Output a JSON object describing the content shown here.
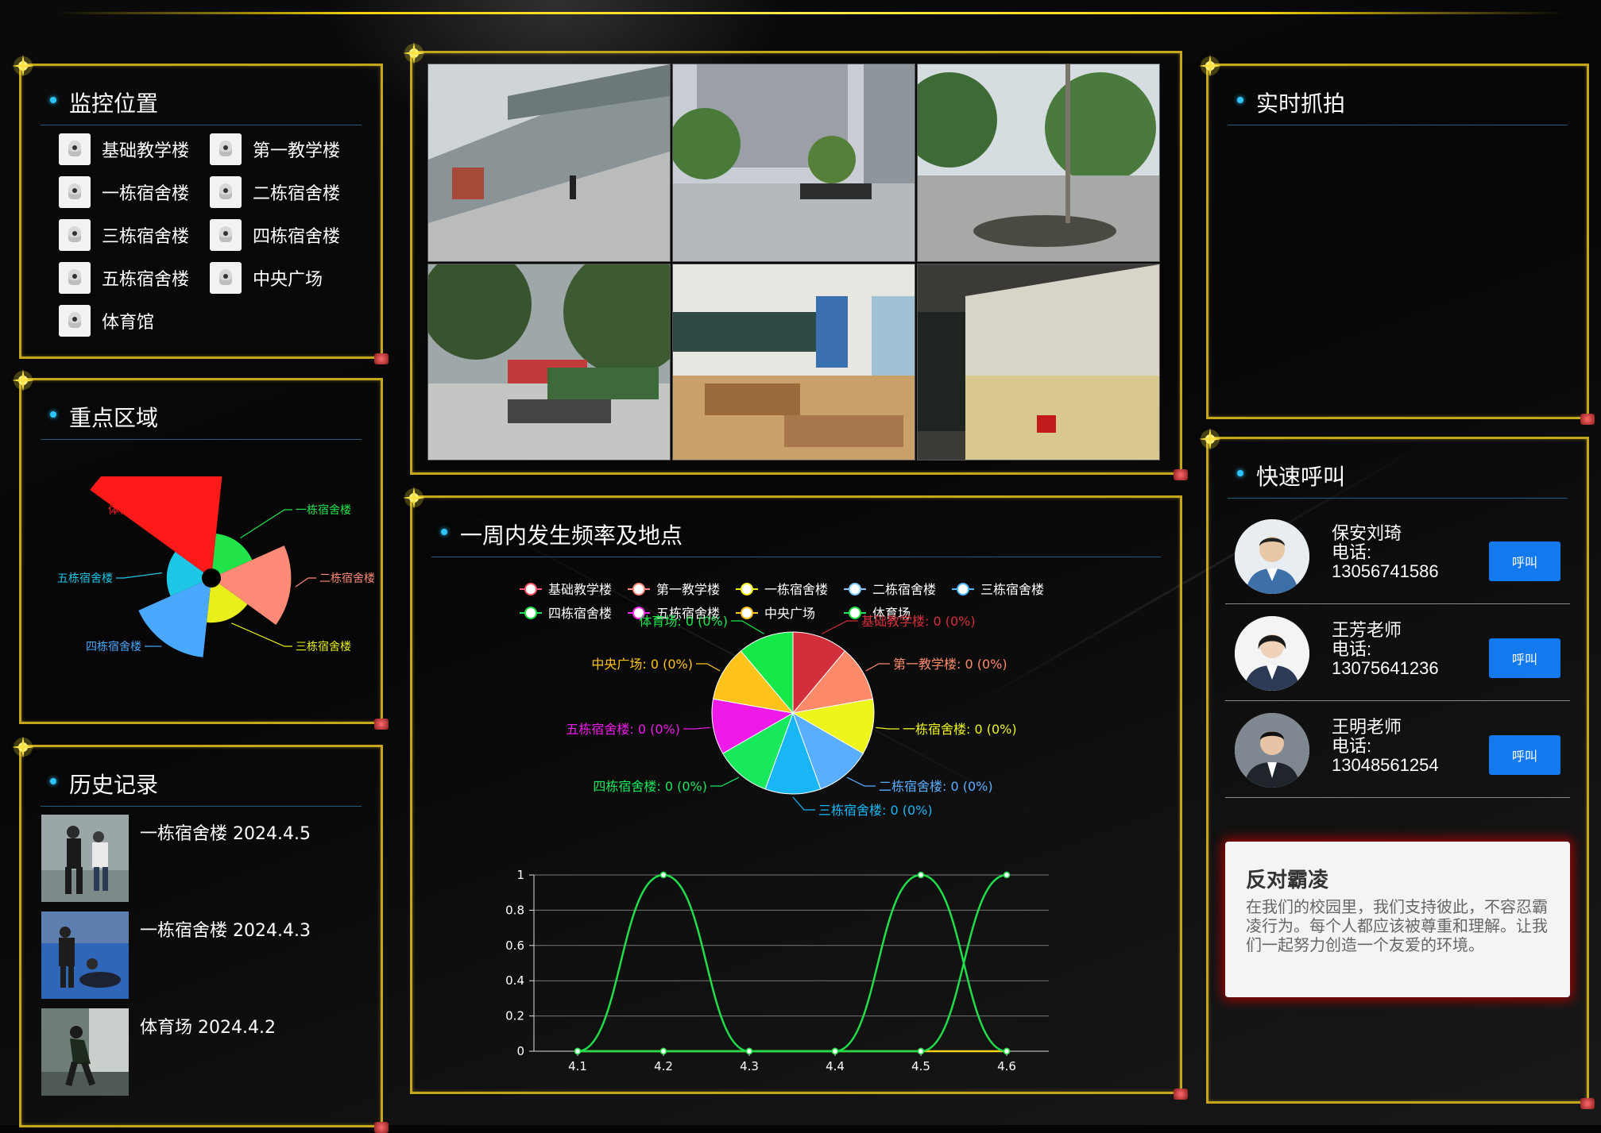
{
  "monitor": {
    "title": "监控位置",
    "cameras": [
      "基础教学楼",
      "第一教学楼",
      "一栋宿舍楼",
      "二栋宿舍楼",
      "三栋宿舍楼",
      "四栋宿舍楼",
      "五栋宿舍楼",
      "中央广场",
      "体育馆"
    ]
  },
  "zones": {
    "title": "重点区域",
    "labels": [
      "一栋宿舍楼",
      "二栋宿舍楼",
      "三栋宿舍楼",
      "四栋宿舍楼",
      "五栋宿舍楼",
      "体育场"
    ]
  },
  "history": {
    "title": "历史记录",
    "items": [
      {
        "text": "一栋宿舍楼 2024.4.5"
      },
      {
        "text": "一栋宿舍楼 2024.4.3"
      },
      {
        "text": "体育场 2024.4.2"
      }
    ]
  },
  "frequency": {
    "title": "一周内发生频率及地点"
  },
  "snapshot": {
    "title": "实时抓拍"
  },
  "quickcall": {
    "title": "快速呼叫",
    "contacts": [
      {
        "name": "保安刘琦",
        "phone_label": "电话:",
        "phone": "13056741586",
        "button": "呼叫"
      },
      {
        "name": "王芳老师",
        "phone_label": "电话:",
        "phone": "13075641236",
        "button": "呼叫"
      },
      {
        "name": "王明老师",
        "phone_label": "电话:",
        "phone": "13048561254",
        "button": "呼叫"
      }
    ]
  },
  "notice": {
    "title": "反对霸凌",
    "body": "在我们的校园里，我们支持彼此，不容忍霸凌行为。每个人都应该被尊重和理解。让我们一起努力创造一个友爱的环境。"
  },
  "chart_data": [
    {
      "type": "pie",
      "chart": "zones-rose",
      "categories": [
        "一栋宿舍楼",
        "二栋宿舍楼",
        "三栋宿舍楼",
        "四栋宿舍楼",
        "五栋宿舍楼",
        "体育场"
      ],
      "values": [
        1,
        2,
        1,
        2,
        1,
        4
      ],
      "colors": [
        "#22e44a",
        "#ff8a75",
        "#e8ef1a",
        "#4aa8ff",
        "#1ec7e6",
        "#ff1a1a"
      ],
      "variant": "rose"
    },
    {
      "type": "pie",
      "chart": "weekly-pie",
      "legend": [
        "基础教学楼",
        "第一教学楼",
        "一栋宿舍楼",
        "二栋宿舍楼",
        "三栋宿舍楼",
        "四栋宿舍楼",
        "五栋宿舍楼",
        "中央广场",
        "体育场"
      ],
      "legend_colors": [
        "#ff5566",
        "#ff8a75",
        "#f5f01a",
        "#7ec8ff",
        "#4fb5ff",
        "#22e44a",
        "#ff2ef0",
        "#ffc41a",
        "#22e44a"
      ],
      "slice_labels": [
        "基础教学楼: 0 (0%)",
        "第一教学楼: 0 (0%)",
        "一栋宿舍楼: 0 (0%)",
        "二栋宿舍楼: 0 (0%)",
        "三栋宿舍楼: 0 (0%)",
        "四栋宿舍楼: 0 (0%)",
        "五栋宿舍楼: 0 (0%)",
        "中央广场: 0 (0%)",
        "体育场: 0 (0%)"
      ],
      "slice_colors": [
        "#d32f3a",
        "#ff8a6a",
        "#eef51a",
        "#5aaeff",
        "#18b6f5",
        "#17e85c",
        "#ee1ae8",
        "#ffc31a",
        "#17e84a"
      ],
      "values": [
        0,
        0,
        0,
        0,
        0,
        0,
        0,
        0,
        0
      ]
    },
    {
      "type": "line",
      "chart": "weekly-line",
      "x": [
        "4.1",
        "4.2",
        "4.3",
        "4.4",
        "4.5",
        "4.6"
      ],
      "ylim": [
        0,
        1
      ],
      "yticks": [
        "0",
        "0.2",
        "0.4",
        "0.6",
        "0.8",
        "1"
      ],
      "series": [
        {
          "color": "#22dd4a",
          "values": [
            0,
            1,
            0,
            0,
            1,
            0
          ]
        },
        {
          "color": "#22dd4a",
          "values": [
            0,
            0,
            0,
            0,
            0,
            1
          ]
        },
        {
          "color": "#ffd21a",
          "values": [
            0,
            0,
            0,
            0,
            0,
            0
          ]
        }
      ]
    }
  ]
}
